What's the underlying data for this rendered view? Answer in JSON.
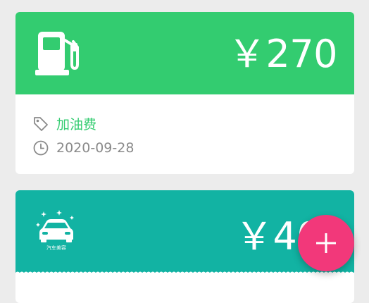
{
  "theme": {
    "fuel_green": "#33cc70",
    "teal": "#12b3a3",
    "fab_pink": "#f2387a"
  },
  "records": [
    {
      "icon": "gas-pump-icon",
      "amount": "￥270",
      "category_icon": "tag-icon",
      "category": "加油费",
      "date_icon": "clock-icon",
      "date": "2020-09-28"
    },
    {
      "icon": "car-wash-icon",
      "icon_caption": "汽车美容",
      "amount": "￥40"
    }
  ],
  "fab": {
    "icon": "plus-icon"
  }
}
